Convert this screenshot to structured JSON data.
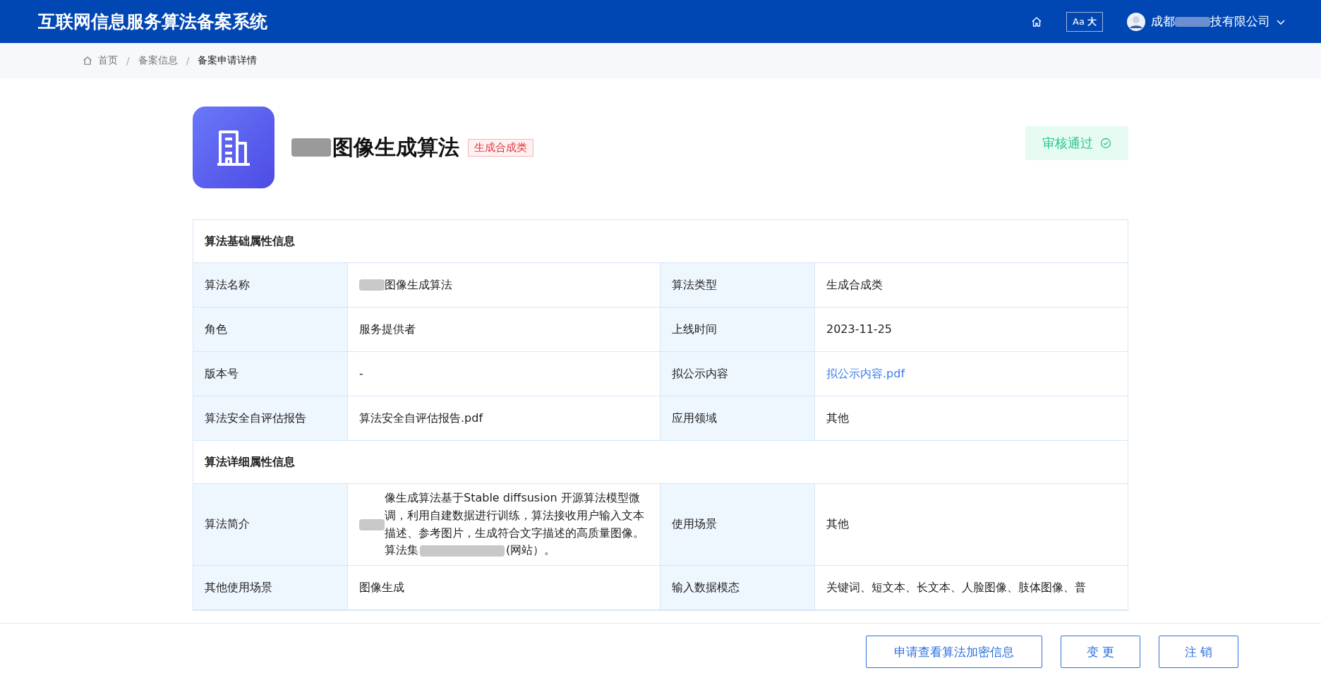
{
  "header": {
    "title": "互联网信息服务算法备案系统",
    "font_toggle": {
      "small": "Aa",
      "large": "大"
    },
    "user": {
      "name_start": "成都",
      "name_end": "技有限公司"
    }
  },
  "breadcrumb_separator": "/",
  "breadcrumb": [
    {
      "label": "首页",
      "current": false
    },
    {
      "label": "备案信息",
      "current": false
    },
    {
      "label": "备案申请详情",
      "current": true
    }
  ],
  "algorithm": {
    "name": "图像生成算法",
    "tag": "生成合成类",
    "status": "审核通过"
  },
  "sections": [
    {
      "title": "算法基础属性信息",
      "rows": [
        {
          "cells": [
            {
              "label": "算法名称",
              "value": "图像生成算法",
              "redacted": true
            },
            {
              "label": "算法类型",
              "value": "生成合成类"
            }
          ]
        },
        {
          "cells": [
            {
              "label": "角色",
              "value": "服务提供者"
            },
            {
              "label": "上线时间",
              "value": "2023-11-25"
            }
          ]
        },
        {
          "cells": [
            {
              "label": "版本号",
              "value": "-"
            },
            {
              "label": "拟公示内容",
              "value": "拟公示内容.pdf",
              "link": true
            }
          ]
        },
        {
          "cells": [
            {
              "label": "算法安全自评估报告",
              "value": "算法安全自评估报告.pdf"
            },
            {
              "label": "应用领域",
              "value": "其他"
            }
          ]
        }
      ]
    },
    {
      "title": "算法详细属性信息",
      "rows": [
        {
          "cells": [
            {
              "label": "算法简介",
              "value": "像生成算法基于Stable diffsusion 开源算法模型微调，利用自建数据进行训练，算法接收用户输入文本描述、参考图片，生成符合文字描述的高质量图像。算法集",
              "value_end": "(网站）。",
              "redacted": true
            },
            {
              "label": "使用场景",
              "value": "其他"
            }
          ]
        },
        {
          "cells": [
            {
              "label": "其他使用场景",
              "value": "图像生成"
            },
            {
              "label": "输入数据模态",
              "value": "关键词、短文本、长文本、人脸图像、肢体图像、普"
            }
          ]
        }
      ]
    }
  ],
  "footer_buttons": [
    "申请查看算法加密信息",
    "变 更",
    "注 销"
  ]
}
